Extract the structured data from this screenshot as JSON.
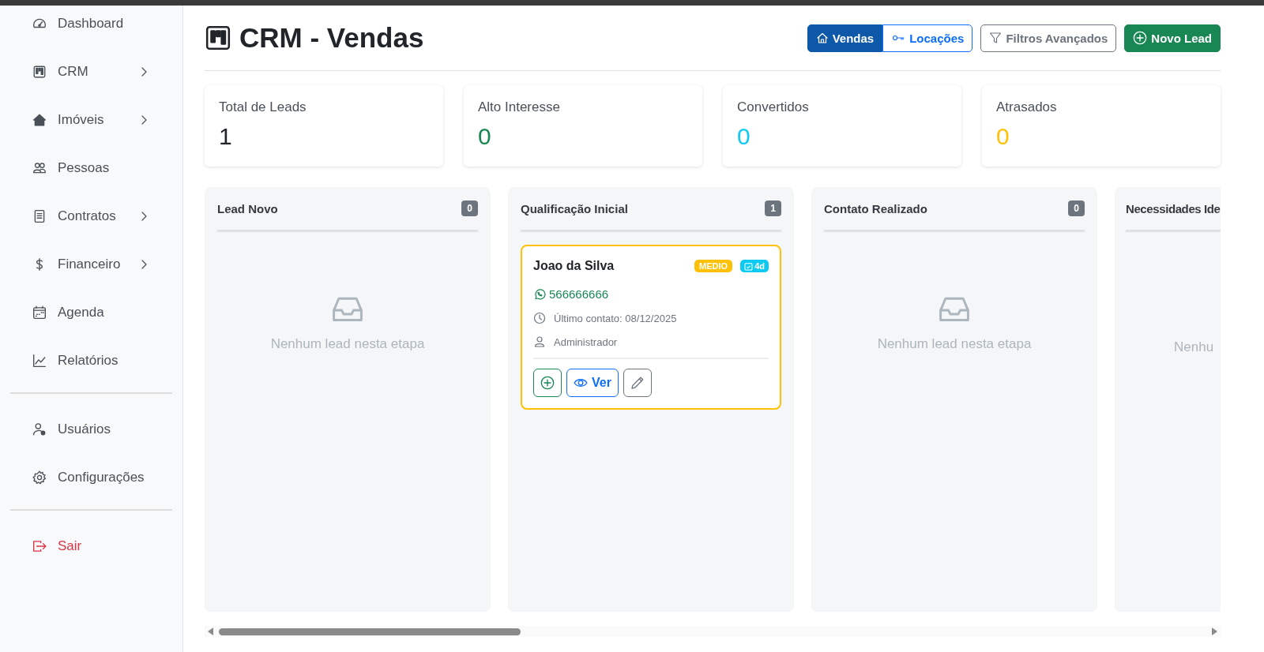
{
  "sidebar": {
    "groups": [
      {
        "items": [
          {
            "label": "Dashboard",
            "has_submenu": false
          },
          {
            "label": "CRM",
            "has_submenu": true
          },
          {
            "label": "Imóveis",
            "has_submenu": true
          },
          {
            "label": "Pessoas",
            "has_submenu": false
          },
          {
            "label": "Contratos",
            "has_submenu": true
          },
          {
            "label": "Financeiro",
            "has_submenu": true
          },
          {
            "label": "Agenda",
            "has_submenu": false
          },
          {
            "label": "Relatórios",
            "has_submenu": false
          }
        ]
      },
      {
        "items": [
          {
            "label": "Usuários",
            "has_submenu": false
          },
          {
            "label": "Configurações",
            "has_submenu": false
          }
        ]
      },
      {
        "items": [
          {
            "label": "Sair",
            "has_submenu": false,
            "kind": "logout"
          }
        ]
      }
    ]
  },
  "header": {
    "title": "CRM - Vendas",
    "mode_toggle": [
      {
        "label": "Vendas",
        "selected": true
      },
      {
        "label": "Locações",
        "selected": false
      }
    ],
    "filter_button": "Filtros Avançados",
    "new_button": "Novo Lead"
  },
  "stats": [
    {
      "label": "Total de Leads",
      "value": "1",
      "color": "#212529"
    },
    {
      "label": "Alto Interesse",
      "value": "0",
      "color": "#198754"
    },
    {
      "label": "Convertidos",
      "value": "0",
      "color": "#0dcaf0"
    },
    {
      "label": "Atrasados",
      "value": "0",
      "color": "#ffc107"
    }
  ],
  "columns": [
    {
      "title": "Lead Novo",
      "count": "0",
      "empty_text": "Nenhum lead nesta etapa",
      "cut": false
    },
    {
      "title": "Qualificação Inicial",
      "count": "1",
      "cut": false,
      "leads": [
        {
          "name": "Joao da Silva",
          "priority": "MEDIO",
          "age": "4d",
          "phone": "566666666",
          "last_contact": "Último contato: 08/12/2025",
          "owner": "Administrador",
          "view_button": "Ver"
        }
      ]
    },
    {
      "title": "Contato Realizado",
      "count": "0",
      "empty_text": "Nenhum lead nesta etapa",
      "cut": false
    },
    {
      "title": "Necessidades Ide",
      "empty_text": "Nenhu",
      "cut": true
    }
  ]
}
